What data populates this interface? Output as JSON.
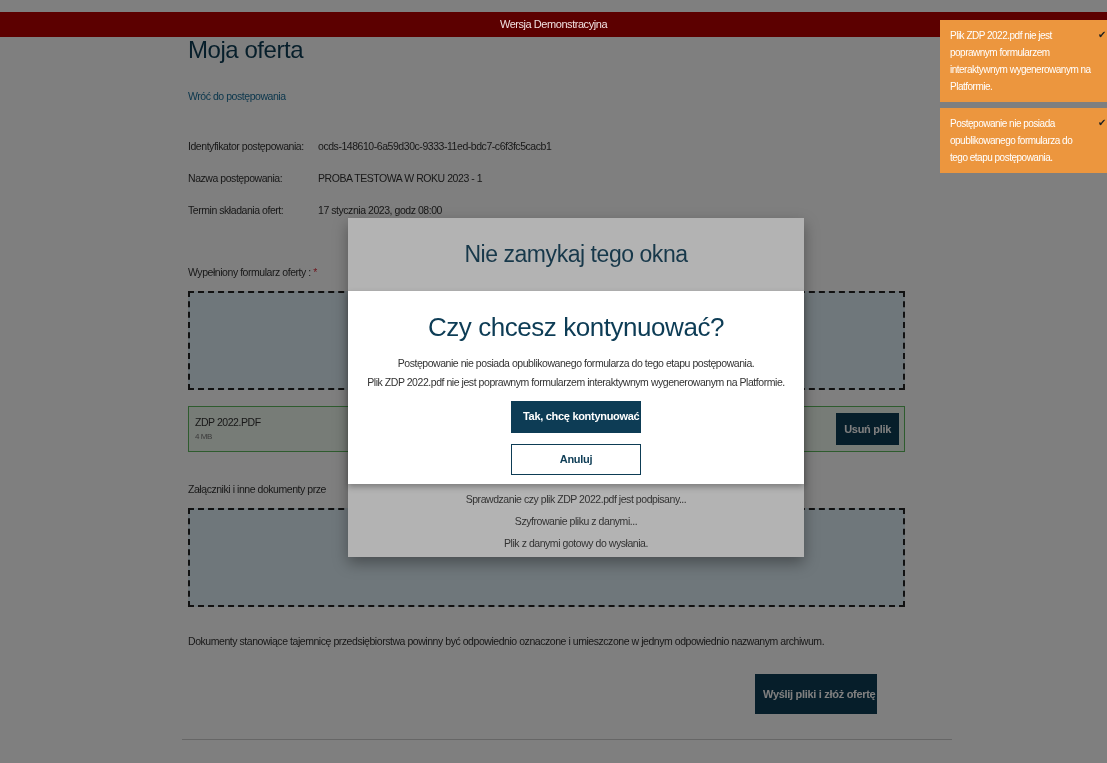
{
  "demo_banner": "Wersja Demonstracyjna",
  "page": {
    "title": "Moja oferta",
    "back_link": "Wróć do postępowania",
    "details": [
      {
        "label": "Identyfikator postępowania:",
        "value": "ocds-148610-6a59d30c-9333-11ed-bdc7-c6f3fc5cacb1"
      },
      {
        "label": "Nazwa postępowania:",
        "value": "PROBA TESTOWA W ROKU 2023 - 1"
      },
      {
        "label": "Termin składania ofert:",
        "value": "17 stycznia 2023, godz 08:00"
      }
    ],
    "offer_form": {
      "label": "Wypełniony formularz oferty :",
      "required_mark": "*"
    },
    "uploaded_file": {
      "name": "ZDP 2022.PDF",
      "size": "4 MB",
      "remove_button": "Usuń plik"
    },
    "attachments_label": "Załączniki i inne dokumenty prze",
    "note": "Dokumenty stanowiące tajemnicę przedsiębiorstwa powinny być odpowiednio oznaczone i umieszczone w jednym odpowiednio nazwanym archiwum.",
    "submit_button": "Wyślij pliki i złóż ofertę"
  },
  "progress_dialog": {
    "title": "Nie zamykaj tego okna",
    "status_lines": [
      "Sprawdzanie czy plik ZDP 2022.pdf jest podpisany...",
      "Szyfrowanie pliku z danymi...",
      "Plik z danymi gotowy do wysłania."
    ]
  },
  "confirm_dialog": {
    "title": "Czy chcesz kontynuować?",
    "messages": [
      "Postępowanie nie posiada opublikowanego formularza do tego etapu postępowania.",
      "Plik ZDP 2022.pdf nie jest poprawnym formularzem interaktywnym wygenerowanym na Platformie."
    ],
    "confirm_button": "Tak, chcę kontynuować",
    "cancel_button": "Anuluj"
  },
  "toasts": [
    {
      "message": "Plik ZDP 2022.pdf nie jest poprawnym formularzem interaktywnym wygenerowanym na Platformie.",
      "check": "✔"
    },
    {
      "message": "Postępowanie nie posiada opublikowanego formularza do tego etapu postępowania.",
      "check": "✔"
    }
  ]
}
